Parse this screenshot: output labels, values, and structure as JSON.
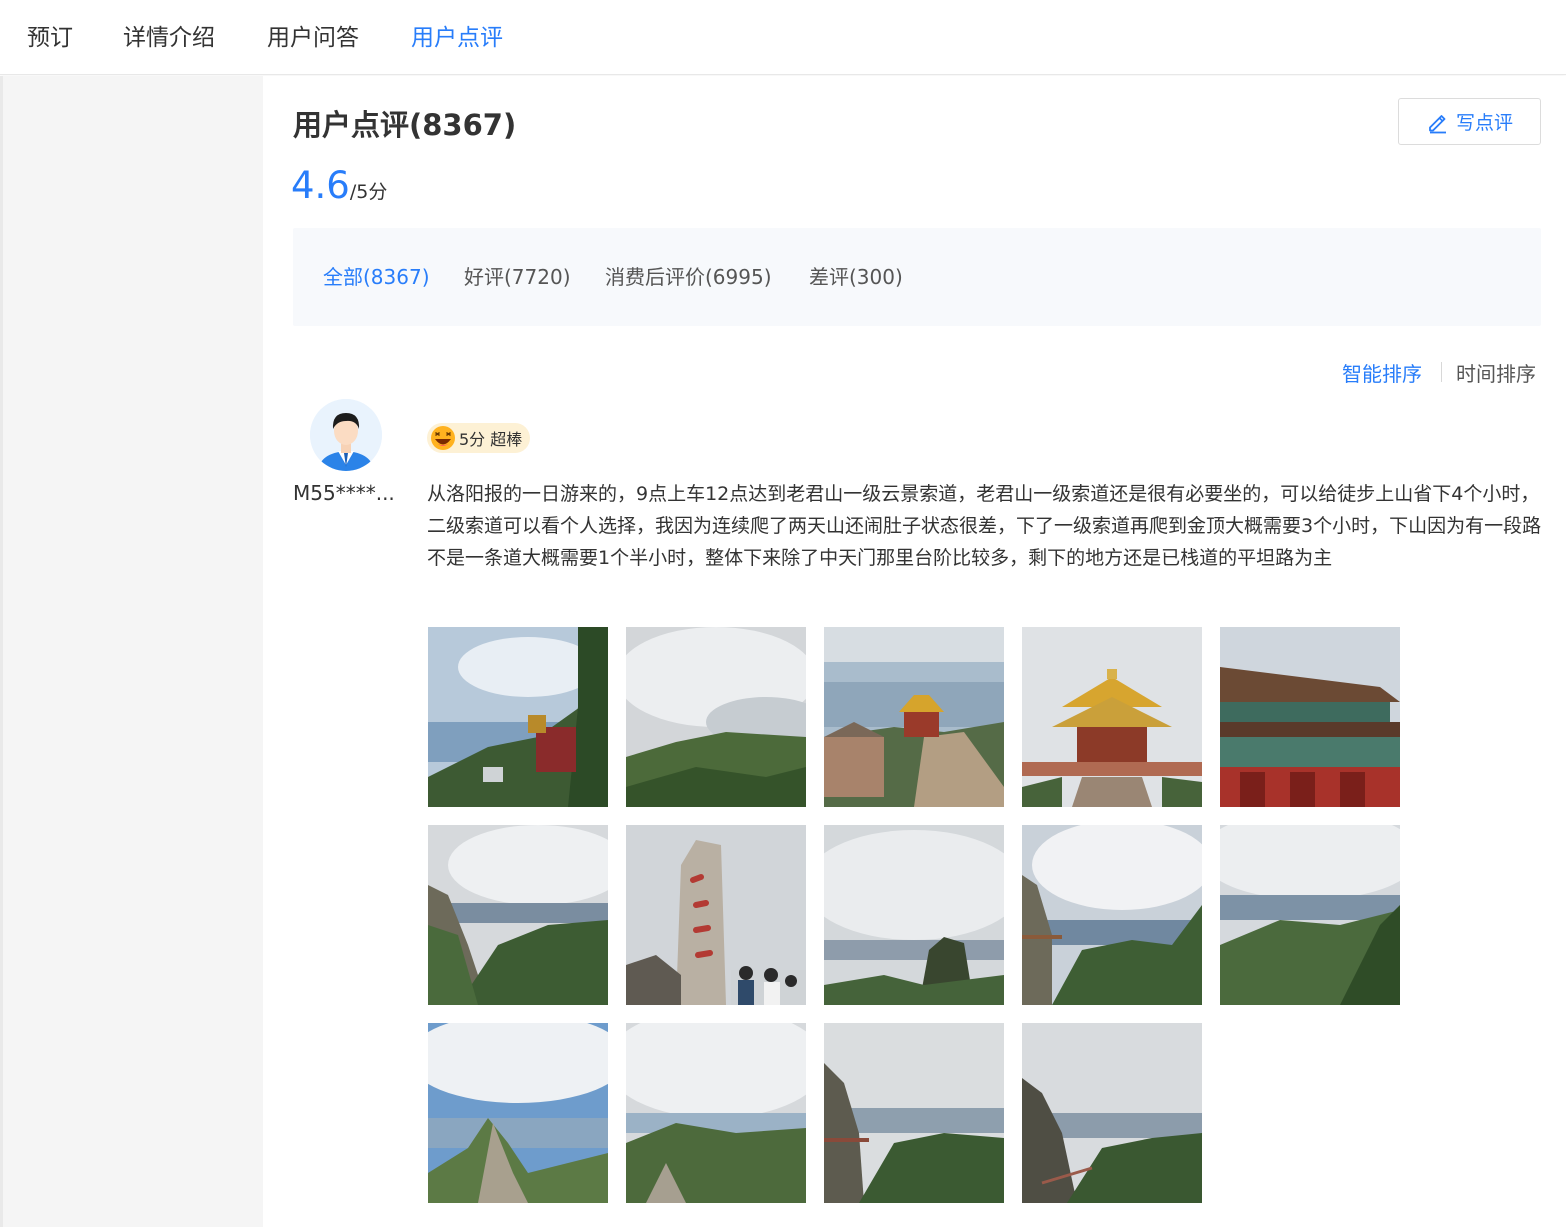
{
  "nav": {
    "tabs": [
      {
        "label": "预订"
      },
      {
        "label": "详情介绍"
      },
      {
        "label": "用户问答"
      },
      {
        "label": "用户点评"
      }
    ],
    "active_index": 3
  },
  "reviews": {
    "title": "用户点评(8367)",
    "write_button": "写点评",
    "score": "4.6",
    "score_suffix": "/5分",
    "filters": [
      {
        "label": "全部(8367)"
      },
      {
        "label": "好评(7720)"
      },
      {
        "label": "消费后评价(6995)"
      },
      {
        "label": "差评(300)"
      }
    ],
    "sort": {
      "smart": "智能排序",
      "time": "时间排序"
    },
    "items": [
      {
        "username": "M55****...",
        "rating_label": "5分 超棒",
        "text": "从洛阳报的一日游来的，9点上车12点达到老君山一级云景索道，老君山一级索道还是很有必要坐的，可以给徒步上山省下4个小时，二级索道可以看个人选择，我因为连续爬了两天山还闹肚子状态很差，下了一级索道再爬到金顶大概需要3个小时，下山因为有一段路不是一条道大概需要1个半小时，整体下来除了中天门那里台阶比较多，剩下的地方还是已栈道的平坦路为主",
        "photo_count": 14
      }
    ]
  },
  "colors": {
    "accent": "#287dfa",
    "badge_bg": "#fdf1d5",
    "filter_bg": "#f7f9fc",
    "sidebar_bg": "#f5f5f5"
  },
  "icons": {
    "write": "pencil-icon",
    "badge": "laughing-face-icon"
  }
}
